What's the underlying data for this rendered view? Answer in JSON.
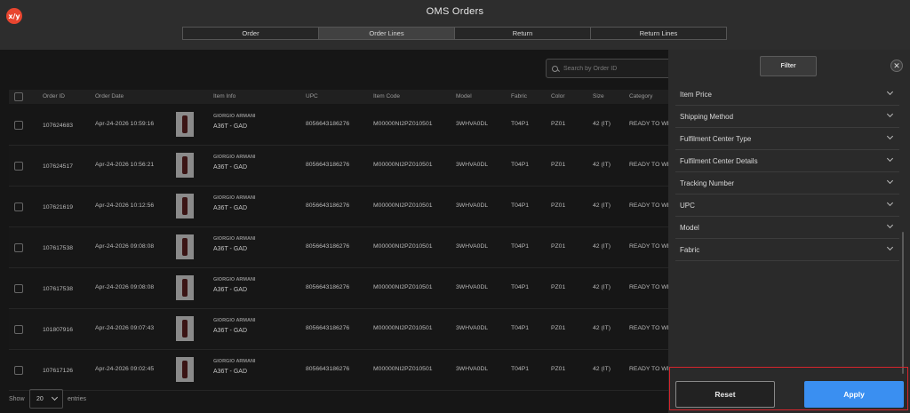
{
  "header": {
    "logo_text": "x/y",
    "title": "OMS Orders",
    "tabs": [
      {
        "label": "Order",
        "active": false
      },
      {
        "label": "Order Lines",
        "active": true
      },
      {
        "label": "Return",
        "active": false
      },
      {
        "label": "Return Lines",
        "active": false
      }
    ]
  },
  "search": {
    "placeholder": "Search by Order ID",
    "value": ""
  },
  "table": {
    "columns": [
      "Order ID",
      "Order Date",
      "Item Info",
      "UPC",
      "Item Code",
      "Model",
      "Fabric",
      "Color",
      "Size",
      "Category"
    ],
    "rows": [
      {
        "order_id": "107624683",
        "date": "Apr-24-2026 10:59:16",
        "brand": "GIORGIO ARMANI",
        "product": "A36T - GAD",
        "upc": "8056643186276",
        "item_code": "M00000NI2PZ010501",
        "model": "3WHVA0DL",
        "fabric": "T04P1",
        "color": "PZ01",
        "size": "42 (IT)",
        "category": "READY TO WE"
      },
      {
        "order_id": "107624517",
        "date": "Apr-24-2026 10:56:21",
        "brand": "GIORGIO ARMANI",
        "product": "A36T - GAD",
        "upc": "8056643186276",
        "item_code": "M00000NI2PZ010501",
        "model": "3WHVA0DL",
        "fabric": "T04P1",
        "color": "PZ01",
        "size": "42 (IT)",
        "category": "READY TO WE"
      },
      {
        "order_id": "107621619",
        "date": "Apr-24-2026 10:12:56",
        "brand": "GIORGIO ARMANI",
        "product": "A36T - GAD",
        "upc": "8056643186276",
        "item_code": "M00000NI2PZ010501",
        "model": "3WHVA0DL",
        "fabric": "T04P1",
        "color": "PZ01",
        "size": "42 (IT)",
        "category": "READY TO WE"
      },
      {
        "order_id": "107617538",
        "date": "Apr-24-2026 09:08:08",
        "brand": "GIORGIO ARMANI",
        "product": "A36T - GAD",
        "upc": "8056643186276",
        "item_code": "M00000NI2PZ010501",
        "model": "3WHVA0DL",
        "fabric": "T04P1",
        "color": "PZ01",
        "size": "42 (IT)",
        "category": "READY TO WE"
      },
      {
        "order_id": "107617538",
        "date": "Apr-24-2026 09:08:08",
        "brand": "GIORGIO ARMANI",
        "product": "A36T - GAD",
        "upc": "8056643186276",
        "item_code": "M00000NI2PZ010501",
        "model": "3WHVA0DL",
        "fabric": "T04P1",
        "color": "PZ01",
        "size": "42 (IT)",
        "category": "READY TO WE"
      },
      {
        "order_id": "101807916",
        "date": "Apr-24-2026 09:07:43",
        "brand": "GIORGIO ARMANI",
        "product": "A36T - GAD",
        "upc": "8056643186276",
        "item_code": "M00000NI2PZ010501",
        "model": "3WHVA0DL",
        "fabric": "T04P1",
        "color": "PZ01",
        "size": "42 (IT)",
        "category": "READY TO WE"
      },
      {
        "order_id": "107617126",
        "date": "Apr-24-2026 09:02:45",
        "brand": "GIORGIO ARMANI",
        "product": "A36T - GAD",
        "upc": "8056643186276",
        "item_code": "M00000NI2PZ010501",
        "model": "3WHVA0DL",
        "fabric": "T04P1",
        "color": "PZ01",
        "size": "42 (IT)",
        "category": "READY TO WE"
      }
    ]
  },
  "footer": {
    "show_label": "Show",
    "entries_value": "20",
    "entries_label": "entries"
  },
  "filter_panel": {
    "title": "Filter",
    "close_glyph": "✕",
    "items": [
      "Item Price",
      "Shipping Method",
      "Fulfilment Center Type",
      "Fulfilment Center Details",
      "Tracking Number",
      "UPC",
      "Model",
      "Fabric"
    ],
    "reset_label": "Reset",
    "apply_label": "Apply"
  },
  "colors": {
    "accent": "#3a8ff1",
    "highlight_border": "#d6252c",
    "logo": "#e8452f"
  }
}
